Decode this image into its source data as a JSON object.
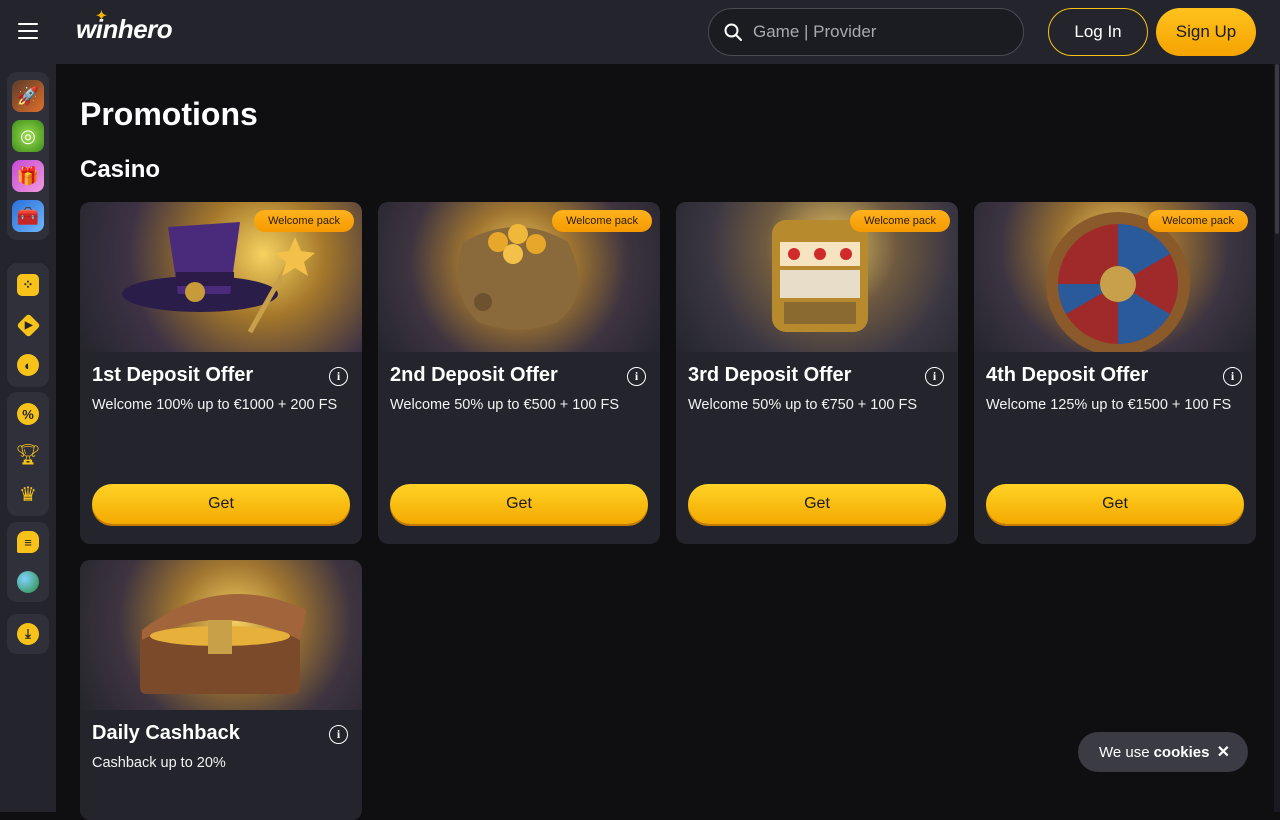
{
  "header": {
    "logo": "winhero",
    "search_placeholder": "Game | Provider",
    "login_label": "Log In",
    "signup_label": "Sign Up"
  },
  "page": {
    "title": "Promotions",
    "section": "Casino"
  },
  "promotions": [
    {
      "badge": "Welcome pack",
      "title": "1st Deposit Offer",
      "desc": "Welcome 100% up to €1000 + 200 FS",
      "button": "Get",
      "image": "wizard-hat"
    },
    {
      "badge": "Welcome pack",
      "title": "2nd Deposit Offer",
      "desc": "Welcome 50% up to €500 + 100 FS",
      "button": "Get",
      "image": "coin-bag"
    },
    {
      "badge": "Welcome pack",
      "title": "3rd Deposit Offer",
      "desc": "Welcome 50% up to €750 + 100 FS",
      "button": "Get",
      "image": "slot-machine"
    },
    {
      "badge": "Welcome pack",
      "title": "4th Deposit Offer",
      "desc": "Welcome 125% up to €1500 + 100 FS",
      "button": "Get",
      "image": "fortune-wheel"
    },
    {
      "title": "Daily Cashback",
      "desc": "Cashback up to 20%",
      "image": "treasure-chest"
    }
  ],
  "sidebar": {
    "game_icons": [
      "rocket-icon",
      "lime-wheel-icon",
      "gift-box-icon",
      "treasure-box-icon"
    ],
    "nav_icons": [
      "dice-icon",
      "diamond-arrow-icon",
      "sports-ball-icon",
      "promo-percent-icon",
      "trophy-icon",
      "crown-icon",
      "chat-icon",
      "globe-icon",
      "download-icon"
    ]
  },
  "cookie": {
    "text": "We use",
    "bold": "cookies",
    "close": "✕"
  },
  "colors": {
    "accent": "#f7c21a",
    "background": "#0f0f12",
    "panel": "#24252c"
  }
}
